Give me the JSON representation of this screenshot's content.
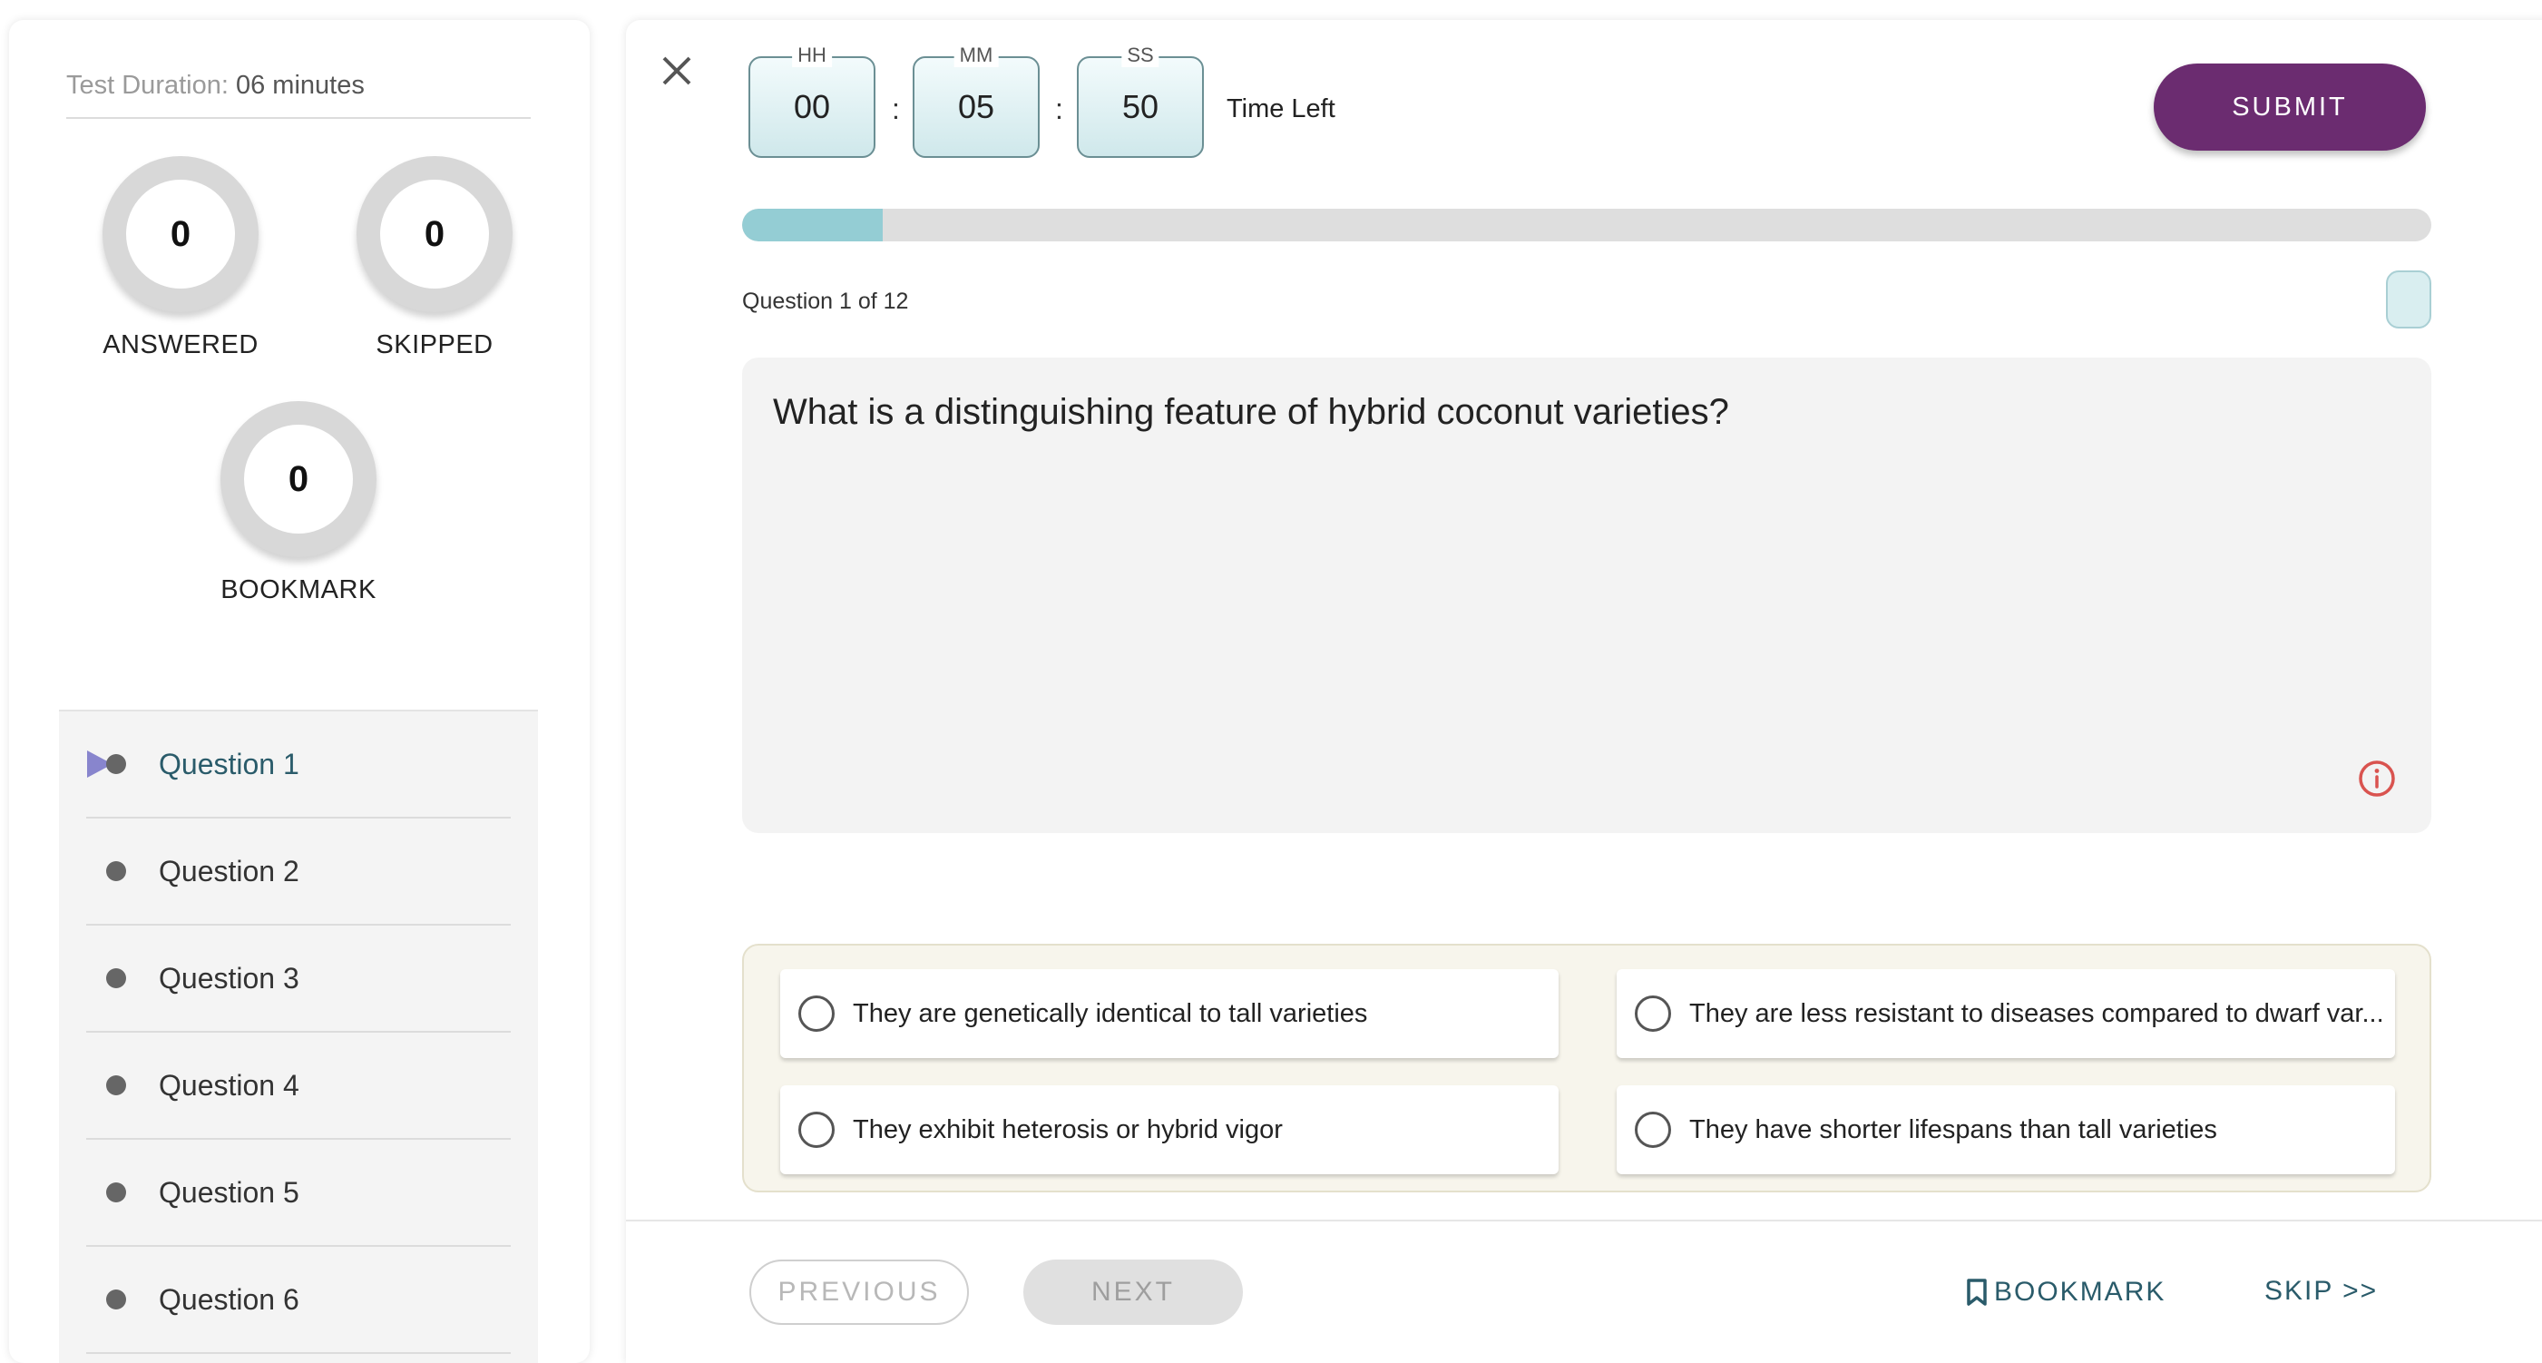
{
  "sidebar": {
    "duration_label": "Test Duration:",
    "duration_value": "06 minutes",
    "stats": {
      "answered": {
        "count": "0",
        "label": "ANSWERED"
      },
      "skipped": {
        "count": "0",
        "label": "SKIPPED"
      },
      "bookmark": {
        "count": "0",
        "label": "BOOKMARK"
      }
    },
    "questions": [
      {
        "label": "Question 1"
      },
      {
        "label": "Question 2"
      },
      {
        "label": "Question 3"
      },
      {
        "label": "Question 4"
      },
      {
        "label": "Question 5"
      },
      {
        "label": "Question 6"
      }
    ]
  },
  "timer": {
    "hh_label": "HH",
    "hh": "00",
    "mm_label": "MM",
    "mm": "05",
    "ss_label": "SS",
    "ss": "50",
    "separator": ":",
    "time_left_label": "Time Left"
  },
  "header": {
    "submit_label": "SUBMIT"
  },
  "progress": {
    "fraction": 0.083
  },
  "question": {
    "counter": "Question 1 of 12",
    "text": "What is a distinguishing feature of hybrid coconut varieties?"
  },
  "options": [
    "They are genetically identical to tall varieties",
    "They are less resistant to diseases compared to dwarf var...",
    "They exhibit heterosis or hybrid vigor",
    "They have shorter lifespans than tall varieties"
  ],
  "footer": {
    "previous_label": "PREVIOUS",
    "next_label": "NEXT",
    "bookmark_label": "BOOKMARK",
    "skip_label": "SKIP >>"
  },
  "colors": {
    "accent": "#6b2c70",
    "progress_fill": "#94cdd4",
    "link": "#2a5b6a",
    "info": "#d9534f"
  },
  "icons": [
    "close-icon",
    "info-icon",
    "bookmark-icon",
    "current-question-arrow-icon"
  ]
}
